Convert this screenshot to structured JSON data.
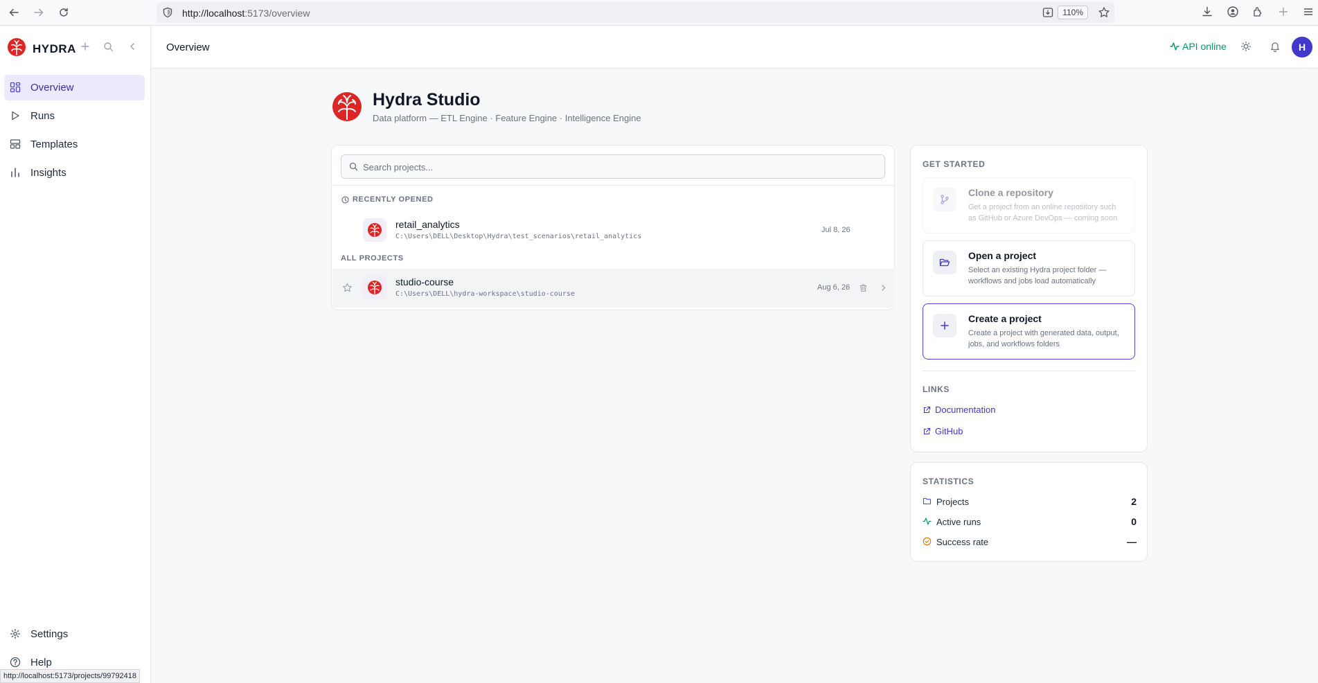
{
  "browser": {
    "url_host": "http://localhost",
    "url_rest": ":5173/overview",
    "zoom": "110%",
    "status_url": "http://localhost:5173/projects/99792418"
  },
  "sidebar": {
    "brand": "HYDRA",
    "nav": [
      {
        "label": "Overview",
        "icon": "grid-icon",
        "active": true
      },
      {
        "label": "Runs",
        "icon": "play-icon"
      },
      {
        "label": "Templates",
        "icon": "layout-icon"
      },
      {
        "label": "Insights",
        "icon": "bar-chart-icon"
      }
    ],
    "bottom": [
      {
        "label": "Settings",
        "icon": "gear-icon"
      },
      {
        "label": "Help",
        "icon": "help-icon"
      }
    ]
  },
  "header": {
    "title": "Overview",
    "api_status": "API online"
  },
  "user": {
    "initial": "H"
  },
  "hero": {
    "title": "Hydra Studio",
    "subtitle": "Data platform — ETL Engine · Feature Engine · Intelligence Engine"
  },
  "projects": {
    "search_placeholder": "Search projects...",
    "recent_label": "RECENTLY OPENED",
    "all_label": "ALL PROJECTS",
    "recent": [
      {
        "name": "retail_analytics",
        "path": "C:\\Users\\DELL\\Desktop\\Hydra\\test_scenarios\\retail_analytics",
        "date": "Jul 8, 26"
      }
    ],
    "all": [
      {
        "name": "studio-course",
        "path": "C:\\Users\\DELL\\hydra-workspace\\studio-course",
        "date": "Aug 6, 26"
      }
    ]
  },
  "get_started": {
    "heading": "GET STARTED",
    "actions": [
      {
        "title": "Clone a repository",
        "desc": "Get a project from an online repository such as GitHub or Azure DevOps — coming soon",
        "icon": "git-branch-icon"
      },
      {
        "title": "Open a project",
        "desc": "Select an existing Hydra project folder — workflows and jobs load automatically",
        "icon": "folder-open-icon"
      },
      {
        "title": "Create a project",
        "desc": "Create a project with generated data, output, jobs, and workflows folders",
        "icon": "plus-icon"
      }
    ],
    "links_heading": "LINKS",
    "links": [
      {
        "label": "Documentation"
      },
      {
        "label": "GitHub"
      }
    ]
  },
  "statistics": {
    "heading": "STATISTICS",
    "items": [
      {
        "label": "Projects",
        "value": "2",
        "color": "#4f46e5"
      },
      {
        "label": "Active runs",
        "value": "0",
        "color": "#059669"
      },
      {
        "label": "Success rate",
        "value": "—",
        "color": "#d97706"
      }
    ]
  },
  "colors": {
    "accent": "#4f46e5",
    "online": "#059669",
    "logo_red": "#dc2626"
  }
}
